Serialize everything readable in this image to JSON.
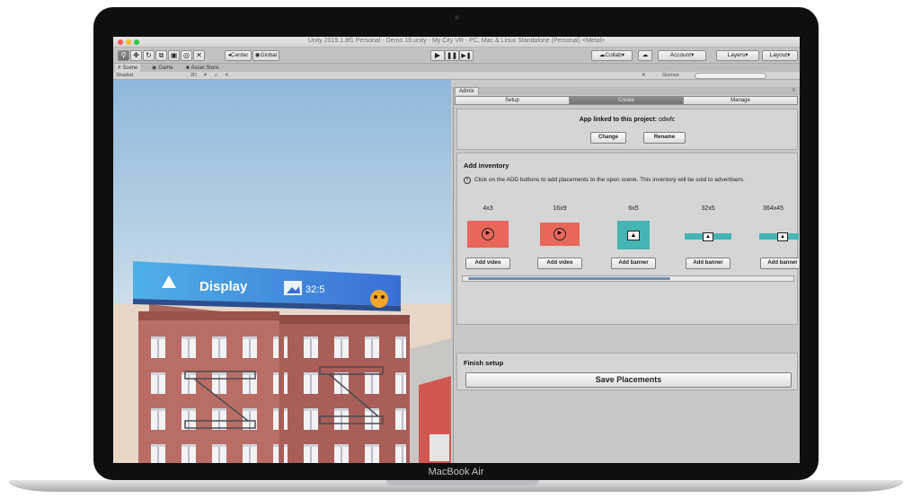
{
  "device": {
    "brand_label": "MacBook Air"
  },
  "window": {
    "title": "Unity 2019.1.8f1 Personal - Demo 19.unity - My City VR - PC, Mac & Linux Standalone (Personal) <Metal>"
  },
  "toolbar": {
    "pivot_label": "Center",
    "space_label": "Global",
    "collab_label": "Collab",
    "account_label": "Account",
    "layers_label": "Layers",
    "layout_label": "Layout"
  },
  "dock_tabs": {
    "scene": "Scene",
    "game": "Game",
    "asset_store": "Asset Store"
  },
  "scene_bar": {
    "shading": "Shaded",
    "mode_2d": "2D",
    "gizmos": "Gizmos"
  },
  "billboard": {
    "brand": "Display",
    "ratio": "32:5"
  },
  "admix": {
    "tab_label": "Admix",
    "sections": [
      "Setup",
      "Create",
      "Manage"
    ],
    "active_section": "Create",
    "linked_label": "App linked to this project:",
    "linked_project": "odwfc",
    "change_label": "Change",
    "rename_label": "Rename",
    "inventory_heading": "Add inventory",
    "inventory_info": "Click on the ADD buttons to add placements to the open scene. This inventory will be sold to advertisers.",
    "slots": [
      {
        "size": "4x3",
        "kind": "video",
        "button": "Add video"
      },
      {
        "size": "16x9",
        "kind": "video",
        "button": "Add video"
      },
      {
        "size": "6x5",
        "kind": "banner",
        "button": "Add banner"
      },
      {
        "size": "32x5",
        "kind": "banner",
        "button": "Add banner"
      },
      {
        "size": "364x45",
        "kind": "banner",
        "button": "Add banner"
      }
    ],
    "finish_heading": "Finish setup",
    "save_label": "Save Placements"
  },
  "colors": {
    "video_thumb": "#e8675b",
    "banner_thumb": "#46b4b4",
    "active_tab": "#7d7d7d"
  }
}
